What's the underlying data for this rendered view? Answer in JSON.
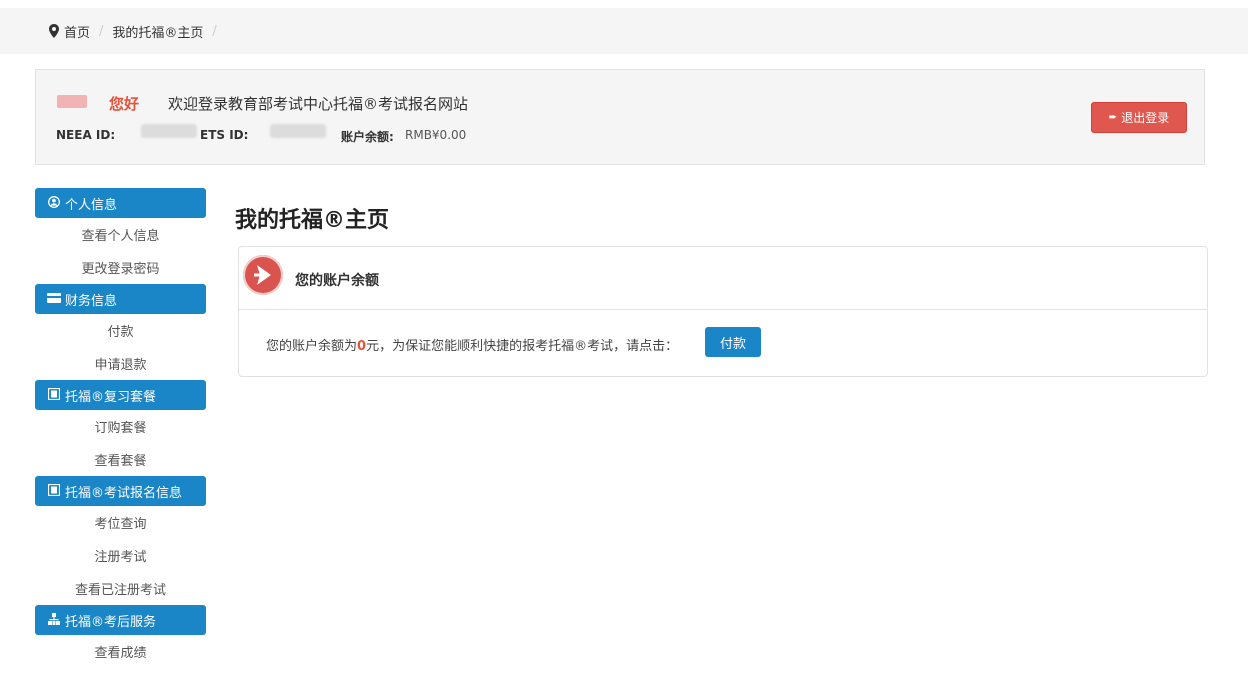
{
  "breadcrumb": {
    "home": "首页",
    "current": "我的托福®主页",
    "separator": "/"
  },
  "user": {
    "greeting": "您好",
    "welcome": "欢迎登录教育部考试中心托福®考试报名网站",
    "neea_label": "NEEA ID:",
    "ets_label": "ETS ID:",
    "balance_label": "账户余额:",
    "balance_value": "RMB¥0.00",
    "logout": "退出登录"
  },
  "sidebar": {
    "groups": [
      {
        "title": "个人信息",
        "icon": "user-circle-icon",
        "items": [
          "查看个人信息",
          "更改登录密码"
        ]
      },
      {
        "title": "财务信息",
        "icon": "credit-card-icon",
        "items": [
          "付款",
          "申请退款"
        ]
      },
      {
        "title": "托福®复习套餐",
        "icon": "book-icon",
        "items": [
          "订购套餐",
          "查看套餐"
        ]
      },
      {
        "title": "托福®考试报名信息",
        "icon": "book-icon",
        "items": [
          "考位查询",
          "注册考试",
          "查看已注册考试"
        ]
      },
      {
        "title": "托福®考后服务",
        "icon": "sitemap-icon",
        "items": [
          "查看成绩"
        ]
      }
    ]
  },
  "main": {
    "title": "我的托福®主页",
    "panel_title": "您的账户余额",
    "pay_text_prefix": "您的账户余额为",
    "pay_amount": "0",
    "pay_text_suffix": "元，为保证您能顺利快捷的报考托福®考试，请点击：",
    "pay_button": "付款"
  },
  "colors": {
    "primary": "#1a86c7",
    "danger": "#e0574f",
    "accent_text": "#e4543b"
  }
}
